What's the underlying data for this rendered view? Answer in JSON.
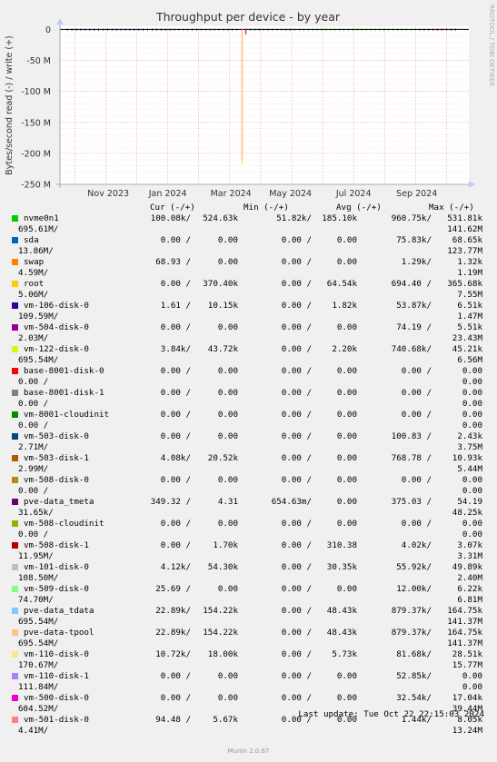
{
  "title": "Throughput per device - by year",
  "side_label": "RRDTOOL / TOBI OETIKER",
  "legend_headers": {
    "cur": "Cur (-/+)",
    "min": "Min (-/+)",
    "avg": "Avg (-/+)",
    "max": "Max (-/+)"
  },
  "legend": [
    {
      "name": "nvme0n1",
      "color": "#00cc00",
      "cur": "100.08k/",
      "cur2": "524.63k",
      "min": "51.82k/",
      "min2": "185.10k",
      "avg": "960.75k/",
      "max": "531.81k",
      "avg2": "695.61M/",
      "max2": "141.62M"
    },
    {
      "name": "sda",
      "color": "#0066b3",
      "cur": "0.00 /",
      "cur2": "0.00",
      "min": "0.00 /",
      "min2": "0.00",
      "avg": "75.83k/",
      "max": "68.65k",
      "avg2": "13.86M/",
      "max2": "123.77M"
    },
    {
      "name": "swap",
      "color": "#ff8000",
      "cur": "68.93 /",
      "cur2": "0.00",
      "min": "0.00 /",
      "min2": "0.00",
      "avg": "1.29k/",
      "max": "1.32k",
      "avg2": "4.59M/",
      "max2": "1.19M"
    },
    {
      "name": "root",
      "color": "#ffcc00",
      "cur": "0.00 /",
      "cur2": "370.40k",
      "min": "0.00 /",
      "min2": "64.54k",
      "avg": "694.40 /",
      "max": "365.68k",
      "avg2": "5.06M/",
      "max2": "7.55M"
    },
    {
      "name": "vm-106-disk-0",
      "color": "#330099",
      "cur": "1.61 /",
      "cur2": "10.15k",
      "min": "0.00 /",
      "min2": "1.82k",
      "avg": "53.87k/",
      "max": "6.51k",
      "avg2": "109.59M/",
      "max2": "1.47M"
    },
    {
      "name": "vm-504-disk-0",
      "color": "#990099",
      "cur": "0.00 /",
      "cur2": "0.00",
      "min": "0.00 /",
      "min2": "0.00",
      "avg": "74.19 /",
      "max": "5.51k",
      "avg2": "2.03M/",
      "max2": "23.43M"
    },
    {
      "name": "vm-122-disk-0",
      "color": "#ccff00",
      "cur": "3.84k/",
      "cur2": "43.72k",
      "min": "0.00 /",
      "min2": "2.20k",
      "avg": "740.68k/",
      "max": "45.21k",
      "avg2": "695.54M/",
      "max2": "6.56M"
    },
    {
      "name": "base-8001-disk-0",
      "color": "#ff0000",
      "cur": "0.00 /",
      "cur2": "0.00",
      "min": "0.00 /",
      "min2": "0.00",
      "avg": "0.00 /",
      "max": "0.00",
      "avg2": "0.00 /",
      "max2": "0.00"
    },
    {
      "name": "base-8001-disk-1",
      "color": "#808080",
      "cur": "0.00 /",
      "cur2": "0.00",
      "min": "0.00 /",
      "min2": "0.00",
      "avg": "0.00 /",
      "max": "0.00",
      "avg2": "0.00 /",
      "max2": "0.00"
    },
    {
      "name": "vm-8001-cloudinit",
      "color": "#008f00",
      "cur": "0.00 /",
      "cur2": "0.00",
      "min": "0.00 /",
      "min2": "0.00",
      "avg": "0.00 /",
      "max": "0.00",
      "avg2": "0.00 /",
      "max2": "0.00"
    },
    {
      "name": "vm-503-disk-0",
      "color": "#00487d",
      "cur": "0.00 /",
      "cur2": "0.00",
      "min": "0.00 /",
      "min2": "0.00",
      "avg": "100.83 /",
      "max": "2.43k",
      "avg2": "2.71M/",
      "max2": "3.75M"
    },
    {
      "name": "vm-503-disk-1",
      "color": "#b35a00",
      "cur": "4.08k/",
      "cur2": "20.52k",
      "min": "0.00 /",
      "min2": "0.00",
      "avg": "768.78 /",
      "max": "10.93k",
      "avg2": "2.99M/",
      "max2": "5.44M"
    },
    {
      "name": "vm-508-disk-0",
      "color": "#b38f00",
      "cur": "0.00 /",
      "cur2": "0.00",
      "min": "0.00 /",
      "min2": "0.00",
      "avg": "0.00 /",
      "max": "0.00",
      "avg2": "0.00 /",
      "max2": "0.00"
    },
    {
      "name": "pve-data_tmeta",
      "color": "#6b006b",
      "cur": "349.32 /",
      "cur2": "4.31",
      "min": "654.63m/",
      "min2": "0.00",
      "avg": "375.03 /",
      "max": "54.19",
      "avg2": "31.65k/",
      "max2": "48.25k"
    },
    {
      "name": "vm-508-cloudinit",
      "color": "#8fb300",
      "cur": "0.00 /",
      "cur2": "0.00",
      "min": "0.00 /",
      "min2": "0.00",
      "avg": "0.00 /",
      "max": "0.00",
      "avg2": "0.00 /",
      "max2": "0.00"
    },
    {
      "name": "vm-508-disk-1",
      "color": "#b30000",
      "cur": "0.00 /",
      "cur2": "1.70k",
      "min": "0.00 /",
      "min2": "310.38",
      "avg": "4.02k/",
      "max": "3.07k",
      "avg2": "11.95M/",
      "max2": "3.31M"
    },
    {
      "name": "vm-101-disk-0",
      "color": "#bebebe",
      "cur": "4.12k/",
      "cur2": "54.30k",
      "min": "0.00 /",
      "min2": "30.35k",
      "avg": "55.92k/",
      "max": "49.89k",
      "avg2": "108.50M/",
      "max2": "2.40M"
    },
    {
      "name": "vm-509-disk-0",
      "color": "#80ff80",
      "cur": "25.69 /",
      "cur2": "0.00",
      "min": "0.00 /",
      "min2": "0.00",
      "avg": "12.00k/",
      "max": "6.22k",
      "avg2": "74.70M/",
      "max2": "6.81M"
    },
    {
      "name": "pve-data_tdata",
      "color": "#80c9ff",
      "cur": "22.89k/",
      "cur2": "154.22k",
      "min": "0.00 /",
      "min2": "48.43k",
      "avg": "879.37k/",
      "max": "164.75k",
      "avg2": "695.54M/",
      "max2": "141.37M"
    },
    {
      "name": "pve-data-tpool",
      "color": "#ffc080",
      "cur": "22.89k/",
      "cur2": "154.22k",
      "min": "0.00 /",
      "min2": "48.43k",
      "avg": "879.37k/",
      "max": "164.75k",
      "avg2": "695.54M/",
      "max2": "141.37M"
    },
    {
      "name": "vm-110-disk-0",
      "color": "#ffe680",
      "cur": "10.72k/",
      "cur2": "18.00k",
      "min": "0.00 /",
      "min2": "5.73k",
      "avg": "81.68k/",
      "max": "28.51k",
      "avg2": "170.67M/",
      "max2": "15.77M"
    },
    {
      "name": "vm-110-disk-1",
      "color": "#aa80ff",
      "cur": "0.00 /",
      "cur2": "0.00",
      "min": "0.00 /",
      "min2": "0.00",
      "avg": "52.85k/",
      "max": "0.00",
      "avg2": "111.84M/",
      "max2": "0.00"
    },
    {
      "name": "vm-500-disk-0",
      "color": "#ee00cc",
      "cur": "0.00 /",
      "cur2": "0.00",
      "min": "0.00 /",
      "min2": "0.00",
      "avg": "32.54k/",
      "max": "17.04k",
      "avg2": "604.52M/",
      "max2": "39.44M"
    },
    {
      "name": "vm-501-disk-0",
      "color": "#ff8080",
      "cur": "94.48 /",
      "cur2": "5.67k",
      "min": "0.00 /",
      "min2": "0.00",
      "avg": "1.44k/",
      "max": "8.05k",
      "avg2": "4.41M/",
      "max2": "13.24M"
    }
  ],
  "last_update": "Last update: Tue Oct 22 22:15:03 2024",
  "version": "Munin 2.0.67",
  "chart_data": {
    "type": "area",
    "title": "Throughput per device - by year",
    "ylabel": "Bytes/second read (-) / write (+)",
    "ylim": [
      -250,
      5
    ],
    "yunit": "M",
    "yticks": [
      0,
      -50,
      -100,
      -150,
      -200,
      -250
    ],
    "ytick_labels": [
      "0",
      "-50 M",
      "-100 M",
      "-150 M",
      "-200 M",
      "-250 M"
    ],
    "x_ticks": [
      {
        "label": "Nov 2023",
        "t": 2023.84
      },
      {
        "label": "Jan 2024",
        "t": 2024.0
      },
      {
        "label": "Mar 2024",
        "t": 2024.17
      },
      {
        "label": "May 2024",
        "t": 2024.33
      },
      {
        "label": "Jul 2024",
        "t": 2024.5
      },
      {
        "label": "Sep 2024",
        "t": 2024.67
      }
    ],
    "x_range": [
      2023.71,
      2024.81
    ],
    "grid": true,
    "spikes": [
      {
        "series": "vm-110-disk-0",
        "t": 2024.2,
        "value": -218,
        "color": "#ffe680"
      },
      {
        "series": "pve-data-tpool",
        "t": 2024.2,
        "value": -210,
        "color": "#ffc080"
      },
      {
        "series": "vm-500-disk-0",
        "t": 2024.21,
        "value": -8,
        "color": "#ee00cc"
      }
    ]
  }
}
